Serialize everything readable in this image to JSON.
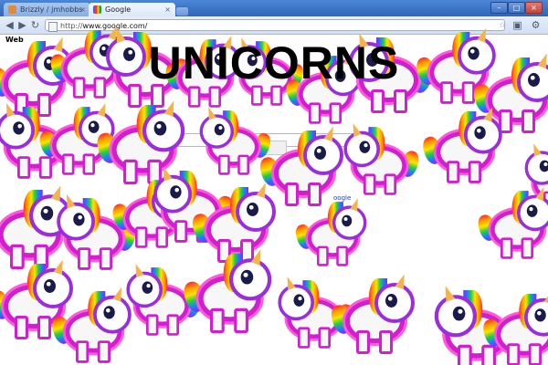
{
  "browser": {
    "tabs": [
      {
        "title": "Brizzly / jmhobbs",
        "active": false
      },
      {
        "title": "Google",
        "active": true
      }
    ],
    "toolbar": {
      "back_icon": "arrow-left",
      "forward_icon": "arrow-right",
      "reload_icon": "refresh",
      "address_prefix": "http://",
      "address_host": "www.google.com/",
      "star_icon": "star"
    }
  },
  "page": {
    "nav_web": "Web",
    "search_button": "Google S",
    "side_link": "oogle"
  },
  "overlay": {
    "title": "UNICORNS"
  }
}
